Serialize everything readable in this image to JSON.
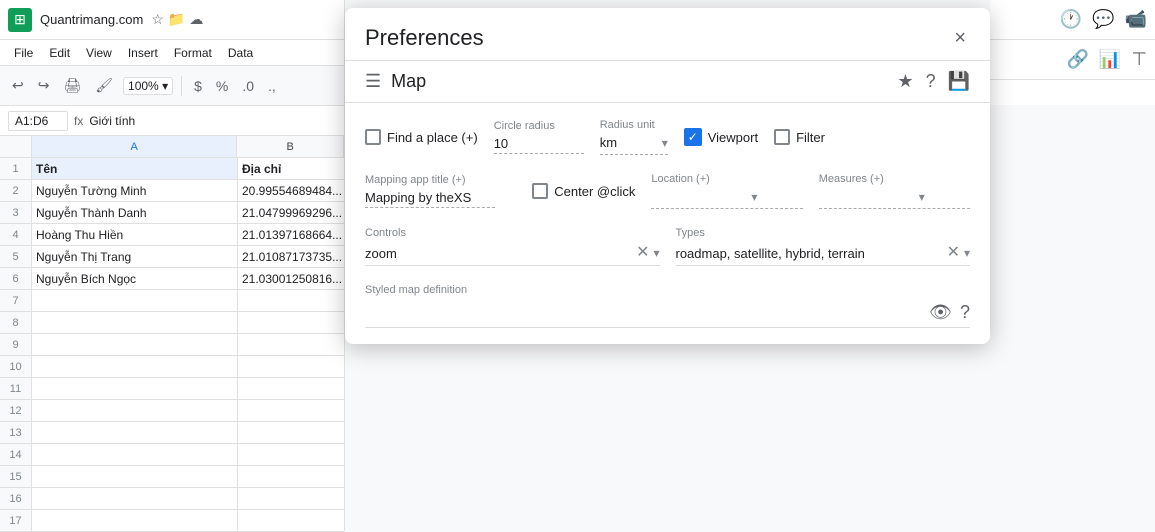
{
  "app": {
    "title": "Quantrimang.com",
    "logo_color": "#0f9d58"
  },
  "menubar": {
    "items": [
      "File",
      "Edit",
      "View",
      "Insert",
      "Format",
      "Data"
    ]
  },
  "toolbar": {
    "zoom": "100%",
    "currency": "$",
    "percent": "%",
    "decimal": ".0"
  },
  "formulabar": {
    "name_box": "A1:D6",
    "formula_prefix": "fx",
    "formula_value": "Giới tính"
  },
  "columns": {
    "headers": [
      "A",
      "B"
    ],
    "widths": [
      206,
      107
    ]
  },
  "rows": [
    {
      "num": "1",
      "a": "Tên",
      "b": "Địa chỉ",
      "header": true
    },
    {
      "num": "2",
      "a": "Nguyễn Tường Minh",
      "b": "20.99554689484..."
    },
    {
      "num": "3",
      "a": "Nguyễn Thành Danh",
      "b": "21.04799969296..."
    },
    {
      "num": "4",
      "a": "Hoàng Thu Hiền",
      "b": "21.01397168664..."
    },
    {
      "num": "5",
      "a": "Nguyễn Thị Trang",
      "b": "21.01087173735..."
    },
    {
      "num": "6",
      "a": "Nguyễn Bích Ngọc",
      "b": "21.03001250816..."
    },
    {
      "num": "7",
      "a": "",
      "b": ""
    },
    {
      "num": "8",
      "a": "",
      "b": ""
    },
    {
      "num": "9",
      "a": "",
      "b": ""
    },
    {
      "num": "10",
      "a": "",
      "b": ""
    },
    {
      "num": "11",
      "a": "",
      "b": ""
    },
    {
      "num": "12",
      "a": "",
      "b": ""
    },
    {
      "num": "13",
      "a": "",
      "b": ""
    },
    {
      "num": "14",
      "a": "",
      "b": ""
    },
    {
      "num": "15",
      "a": "",
      "b": ""
    },
    {
      "num": "16",
      "a": "",
      "b": ""
    },
    {
      "num": "17",
      "a": "",
      "b": ""
    }
  ],
  "dialog": {
    "title": "Preferences",
    "close_label": "×",
    "map_label": "Map",
    "find_place_label": "Find a place (+)",
    "find_place_checked": false,
    "circle_radius_label": "Circle radius",
    "circle_radius_value": "10",
    "radius_unit_label": "Radius unit",
    "radius_unit_value": "km",
    "viewport_label": "Viewport",
    "viewport_checked": true,
    "filter_label": "Filter",
    "filter_checked": false,
    "mapping_app_label": "Mapping app title (+)",
    "mapping_app_value": "Mapping by theXS",
    "center_click_label": "Center @click",
    "center_click_checked": false,
    "location_label": "Location (+)",
    "location_value": "",
    "measures_label": "Measures (+)",
    "measures_value": "",
    "controls_label": "Controls",
    "controls_value": "zoom",
    "types_label": "Types",
    "types_value": "roadmap, satellite, hybrid, terrain",
    "styled_map_label": "Styled map definition",
    "styled_map_value": ""
  }
}
